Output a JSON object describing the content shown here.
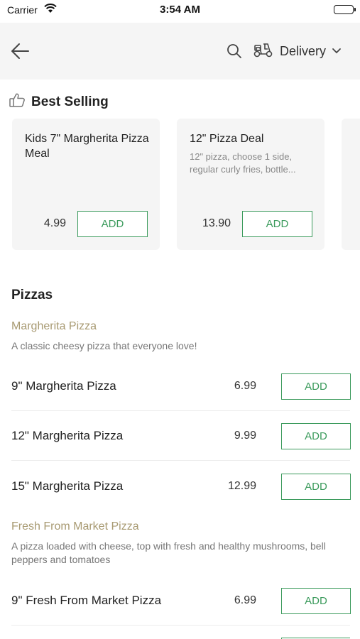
{
  "status_bar": {
    "carrier": "Carrier",
    "time": "3:54 AM"
  },
  "nav": {
    "delivery_label": "Delivery"
  },
  "best_selling": {
    "title": "Best Selling",
    "items": [
      {
        "name": "Kids 7\" Margherita Pizza Meal",
        "description": "",
        "price": "4.99",
        "button": "ADD"
      },
      {
        "name": "12\" Pizza Deal",
        "description": "12\" pizza, choose 1 side, regular curly fries, bottle...",
        "price": "13.90",
        "button": "ADD"
      }
    ]
  },
  "pizzas": {
    "title": "Pizzas",
    "groups": [
      {
        "name": "Margherita Pizza",
        "description": "A classic cheesy pizza that everyone love!",
        "items": [
          {
            "name": "9\" Margherita Pizza",
            "price": "6.99",
            "button": "ADD"
          },
          {
            "name": "12\" Margherita Pizza",
            "price": "9.99",
            "button": "ADD"
          },
          {
            "name": "15\" Margherita Pizza",
            "price": "12.99",
            "button": "ADD"
          }
        ]
      },
      {
        "name": "Fresh From Market Pizza",
        "description": "A pizza loaded with cheese, top with fresh and healthy mushrooms, bell peppers and tomatoes",
        "items": [
          {
            "name": "9\" Fresh From Market Pizza",
            "price": "6.99",
            "button": "ADD"
          }
        ]
      }
    ]
  },
  "colors": {
    "accent_green": "#3a9a5b",
    "subhead_tan": "#a89a72",
    "nav_bg": "#f5f5f5"
  },
  "icons": [
    "wifi-icon",
    "battery-icon",
    "back-arrow-icon",
    "search-icon",
    "scooter-icon",
    "chevron-down-icon",
    "thumbs-up-icon"
  ]
}
